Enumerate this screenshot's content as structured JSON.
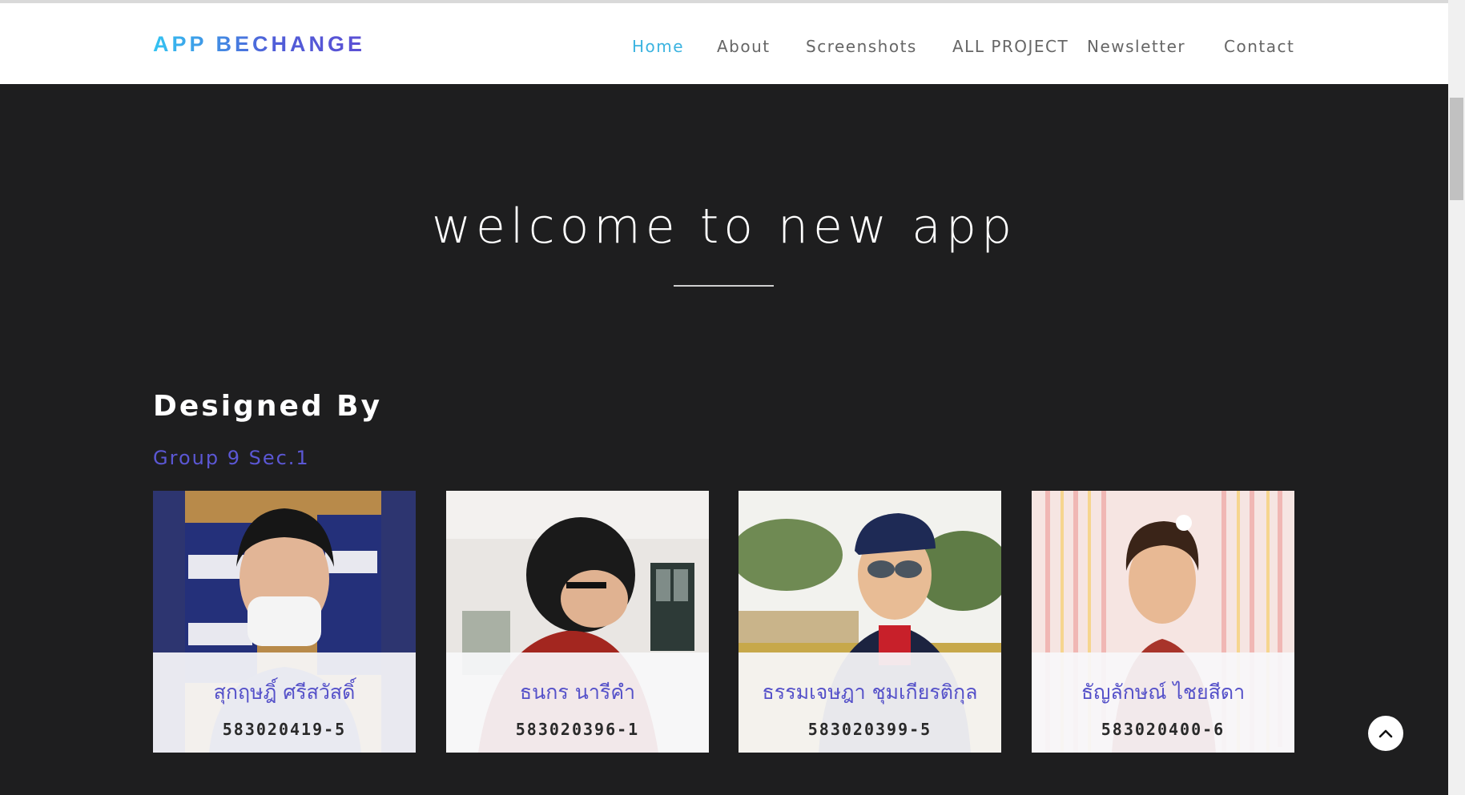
{
  "header": {
    "brand": "APP BECHANGE",
    "nav": [
      {
        "label": "Home",
        "active": true
      },
      {
        "label": "About",
        "active": false
      },
      {
        "label": "Screenshots",
        "active": false
      },
      {
        "label": "ALL PROJECT",
        "active": false
      },
      {
        "label": "Newsletter",
        "active": false
      },
      {
        "label": "Contact",
        "active": false
      }
    ]
  },
  "hero": {
    "title": "welcome to new app"
  },
  "team": {
    "heading": "Designed By",
    "group": "Group 9 Sec.1",
    "members": [
      {
        "name": "สุกฤษฎิ์ ศรีสวัสดิ์",
        "id": "583020419-5"
      },
      {
        "name": "ธนกร นารีคำ",
        "id": "583020396-1"
      },
      {
        "name": "ธรรมเจษฎา ชุมเกียรติกุล",
        "id": "583020399-5"
      },
      {
        "name": "ธัญลักษณ์ ไชยสีดา",
        "id": "583020400-6"
      }
    ]
  },
  "colors": {
    "accent_nav": "#3bb3e0",
    "accent_text": "#5b57d4",
    "background": "#1e1e1f"
  },
  "icons": {
    "back_to_top": "chevron-up-icon"
  }
}
